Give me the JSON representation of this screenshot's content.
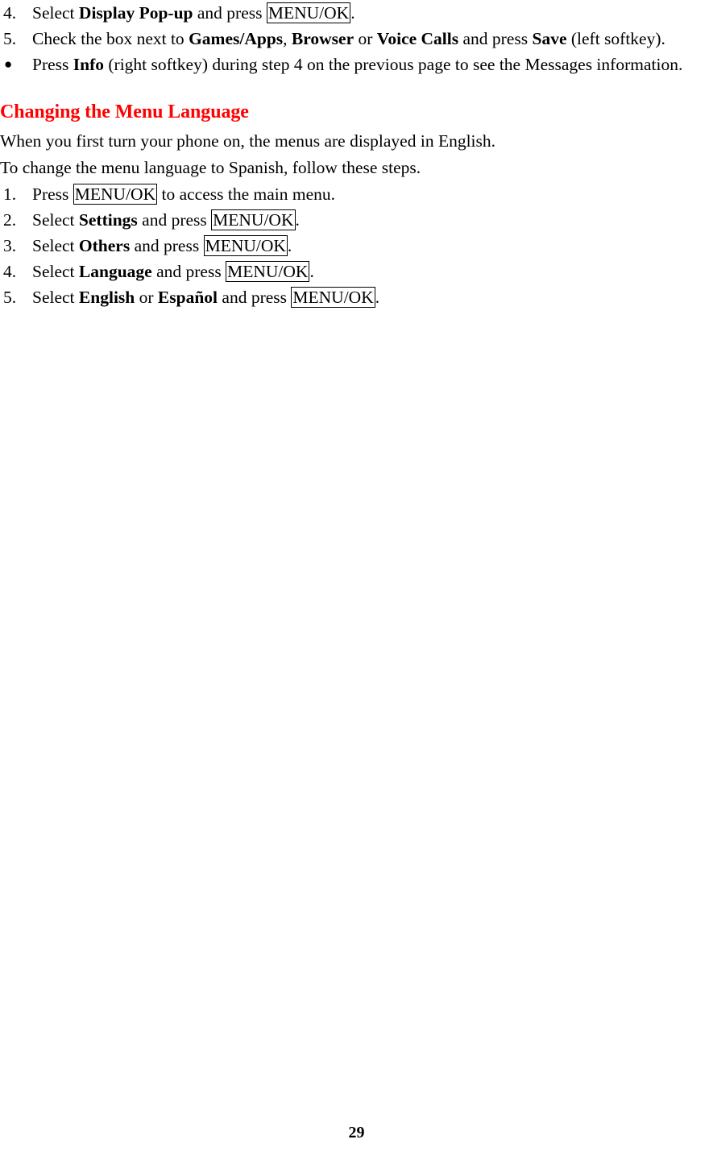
{
  "document": {
    "page_number": "29",
    "heading_color": "#FF0000",
    "text_color": "#000000",
    "background_color": "#FFFFFF"
  },
  "top_section": {
    "steps": [
      {
        "marker": "4.",
        "type": "numbered",
        "parts": [
          {
            "text": "Select ",
            "style": "normal"
          },
          {
            "text": "Display Pop-up",
            "style": "bold"
          },
          {
            "text": " and press ",
            "style": "normal"
          },
          {
            "text": "MENU/OK",
            "style": "key"
          },
          {
            "text": ".",
            "style": "normal"
          }
        ]
      },
      {
        "marker": "5.",
        "type": "numbered",
        "parts": [
          {
            "text": "Check the box next to ",
            "style": "normal"
          },
          {
            "text": "Games/Apps",
            "style": "bold"
          },
          {
            "text": ", ",
            "style": "normal"
          },
          {
            "text": "Browser",
            "style": "bold"
          },
          {
            "text": " or ",
            "style": "normal"
          },
          {
            "text": "Voice Calls",
            "style": "bold"
          },
          {
            "text": " and press ",
            "style": "normal"
          },
          {
            "text": "Save",
            "style": "bold"
          },
          {
            "text": " (left softkey).",
            "style": "normal"
          }
        ]
      },
      {
        "marker": "●",
        "type": "bullet",
        "parts": [
          {
            "text": "Press ",
            "style": "normal"
          },
          {
            "text": "Info",
            "style": "bold"
          },
          {
            "text": " (right softkey) during step 4 on the previous page to see the Messages information.",
            "style": "normal"
          }
        ]
      }
    ]
  },
  "section": {
    "heading": "Changing the Menu Language",
    "intro_lines": [
      "When you first turn your phone on, the menus are displayed in English.",
      "To change the menu language to Spanish, follow these steps."
    ],
    "steps": [
      {
        "marker": "1.",
        "type": "numbered",
        "parts": [
          {
            "text": "Press ",
            "style": "normal"
          },
          {
            "text": "MENU/OK",
            "style": "key"
          },
          {
            "text": " to access the main menu.",
            "style": "normal"
          }
        ]
      },
      {
        "marker": "2.",
        "type": "numbered",
        "parts": [
          {
            "text": "Select ",
            "style": "normal"
          },
          {
            "text": "Settings",
            "style": "bold"
          },
          {
            "text": " and press ",
            "style": "normal"
          },
          {
            "text": "MENU/OK",
            "style": "key"
          },
          {
            "text": ".",
            "style": "normal"
          }
        ]
      },
      {
        "marker": "3.",
        "type": "numbered",
        "parts": [
          {
            "text": "Select ",
            "style": "normal"
          },
          {
            "text": "Others",
            "style": "bold"
          },
          {
            "text": " and press ",
            "style": "normal"
          },
          {
            "text": "MENU/OK",
            "style": "key"
          },
          {
            "text": ".",
            "style": "normal"
          }
        ]
      },
      {
        "marker": "4.",
        "type": "numbered",
        "parts": [
          {
            "text": "Select ",
            "style": "normal"
          },
          {
            "text": "Language",
            "style": "bold"
          },
          {
            "text": " and press ",
            "style": "normal"
          },
          {
            "text": "MENU/OK",
            "style": "key"
          },
          {
            "text": ".",
            "style": "normal"
          }
        ]
      },
      {
        "marker": "5.",
        "type": "numbered",
        "parts": [
          {
            "text": "Select ",
            "style": "normal"
          },
          {
            "text": "English",
            "style": "bold"
          },
          {
            "text": " or ",
            "style": "normal"
          },
          {
            "text": "Español",
            "style": "bold"
          },
          {
            "text": " and press ",
            "style": "normal"
          },
          {
            "text": "MENU/OK",
            "style": "key"
          },
          {
            "text": ".",
            "style": "normal"
          }
        ]
      }
    ]
  }
}
